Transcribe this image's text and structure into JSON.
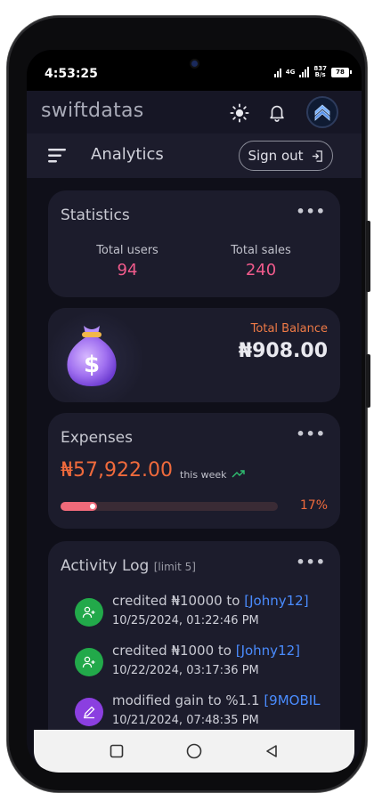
{
  "status_bar": {
    "time": "4:53:25",
    "network": "4G",
    "speed_value": "837",
    "speed_unit": "B/s",
    "battery": "78"
  },
  "app": {
    "brand": "swiftdatas"
  },
  "subheader": {
    "title": "Analytics",
    "signout_label": "Sign out"
  },
  "statistics": {
    "title": "Statistics",
    "more": "•••",
    "items": [
      {
        "label": "Total users",
        "value": "94"
      },
      {
        "label": "Total sales",
        "value": "240"
      }
    ]
  },
  "balance": {
    "label": "Total Balance",
    "value": "₦908.00"
  },
  "expenses": {
    "title": "Expenses",
    "more": "•••",
    "amount": "₦57,922.00",
    "period": "this week",
    "percent_label": "17%",
    "progress_fraction": 0.17
  },
  "activity": {
    "title": "Activity Log",
    "limit": "[limit 5]",
    "more": "•••",
    "items": [
      {
        "type": "user-add",
        "text": "credited ₦10000  to ",
        "link": "[Johny12]",
        "time": "10/25/2024, 01:22:46 PM"
      },
      {
        "type": "user-add",
        "text": "credited ₦1000  to ",
        "link": "[Johny12]",
        "time": "10/22/2024, 03:17:36 PM"
      },
      {
        "type": "edit",
        "text": "modified gain to %1.1 ",
        "link": "[9MOBIL",
        "time": "10/21/2024, 07:48:35 PM"
      }
    ]
  },
  "colors": {
    "accent_pink": "#f15b8c",
    "accent_orange": "#ef6a3c",
    "link_blue": "#4a8cff",
    "card_bg": "#1c1c2c",
    "page_bg": "#0f0f19",
    "icon_green": "#22a94a",
    "icon_purple": "#8b3fe0"
  }
}
